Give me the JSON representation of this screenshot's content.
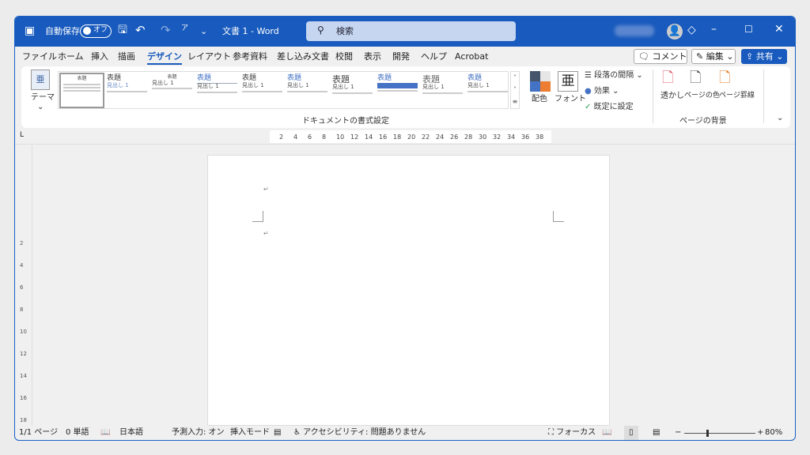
{
  "titlebar": {
    "autosave": "自動保存",
    "autosave_state": "オフ",
    "doc_title": "文書 1  -  Word",
    "search_placeholder": "検索"
  },
  "tabs": [
    "ファイル",
    "ホーム",
    "挿入",
    "描画",
    "デザイン",
    "レイアウト",
    "参考資料",
    "差し込み文書",
    "校閲",
    "表示",
    "開発",
    "ヘルプ",
    "Acrobat"
  ],
  "active_tab": "デザイン",
  "actions": {
    "comment": "コメント",
    "edit": "編集",
    "share": "共有"
  },
  "ribbon": {
    "theme": "テーマ",
    "styles": [
      "表題",
      "表題",
      "表題",
      "表題",
      "表題",
      "表題",
      "表題",
      "表題",
      "表題",
      "表題"
    ],
    "style_sub": "見出し 1",
    "group1": "ドキュメントの書式設定",
    "colors": "配色",
    "fonts": "フォント",
    "paragraph_spacing": "段落の間隔",
    "effects": "効果",
    "set_default": "既定に設定",
    "watermark": "透かし",
    "page_color": "ページの色",
    "page_borders": "ページ罫線",
    "group2": "ページの背景"
  },
  "ruler": [
    "2",
    "4",
    "6",
    "8",
    "10",
    "12",
    "14",
    "16",
    "18",
    "20",
    "22",
    "24",
    "26",
    "28",
    "30",
    "32",
    "34",
    "36",
    "38"
  ],
  "vruler": [
    "2",
    "4",
    "6",
    "8",
    "10",
    "12",
    "14",
    "16",
    "18"
  ],
  "status": {
    "page": "1/1 ページ",
    "words": "0 単語",
    "language": "日本語",
    "predict": "予測入力: オン",
    "mode": "挿入モード",
    "accessibility": "アクセシビリティ: 問題ありません",
    "focus": "フォーカス",
    "zoom": "80%"
  },
  "zoom_percent": 80,
  "colors": {
    "accent": "#185abd"
  }
}
